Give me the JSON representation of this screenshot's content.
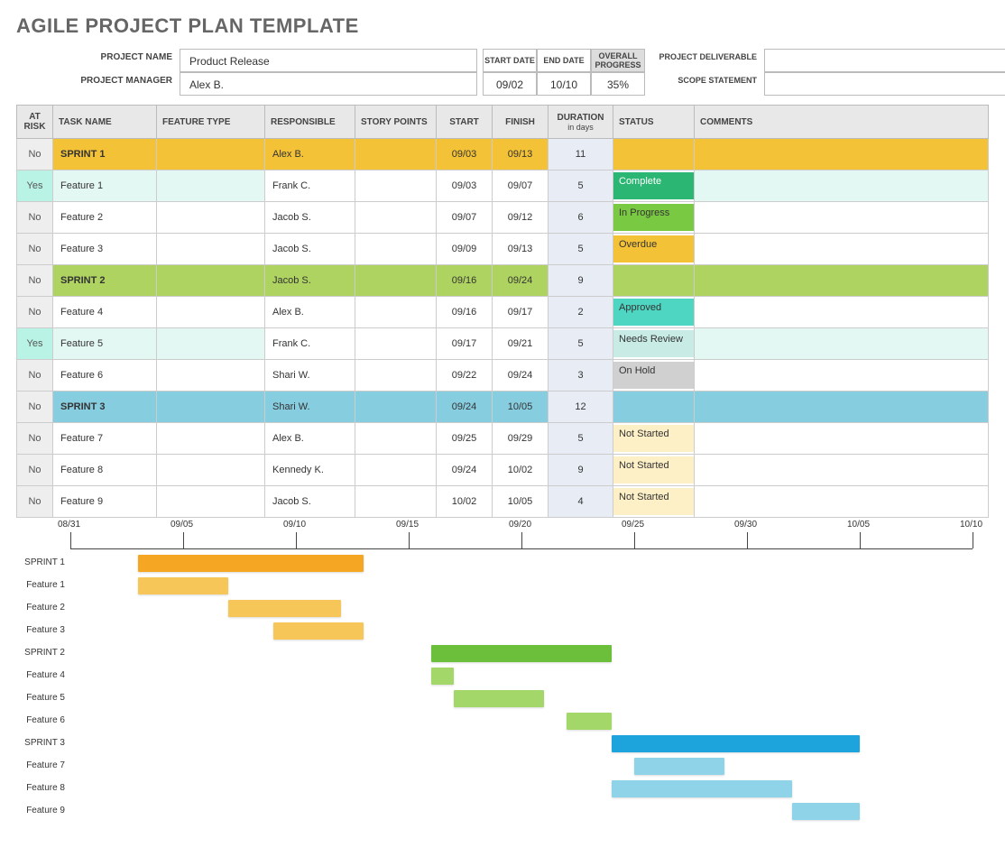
{
  "title": "AGILE PROJECT PLAN TEMPLATE",
  "header": {
    "labels": {
      "project_name": "PROJECT NAME",
      "project_manager": "PROJECT MANAGER",
      "start_date": "START DATE",
      "end_date": "END DATE",
      "overall_progress": "OVERALL PROGRESS",
      "project_deliverable": "PROJECT DELIVERABLE",
      "scope_statement": "SCOPE STATEMENT"
    },
    "project_name": "Product Release",
    "project_manager": "Alex B.",
    "start_date": "09/02",
    "end_date": "10/10",
    "overall_progress": "35%",
    "project_deliverable": "",
    "scope_statement": ""
  },
  "table": {
    "headers": {
      "at_risk": "AT RISK",
      "task_name": "TASK NAME",
      "feature_type": "FEATURE TYPE",
      "responsible": "RESPONSIBLE",
      "story_points": "STORY POINTS",
      "start": "START",
      "finish": "FINISH",
      "duration": "DURATION",
      "duration_sub": "in days",
      "status": "STATUS",
      "comments": "COMMENTS"
    },
    "rows": [
      {
        "at_risk": "No",
        "task": "SPRINT 1",
        "feature_type": "",
        "responsible": "Alex B.",
        "story_points": "",
        "start": "09/03",
        "finish": "09/13",
        "duration": "11",
        "status": "",
        "status_class": "",
        "row_class": "sprint1"
      },
      {
        "at_risk": "Yes",
        "task": "Feature 1",
        "feature_type": "",
        "responsible": "Frank C.",
        "story_points": "",
        "start": "09/03",
        "finish": "09/07",
        "duration": "5",
        "status": "Complete",
        "status_class": "st-complete",
        "row_class": "riskyes"
      },
      {
        "at_risk": "No",
        "task": "Feature 2",
        "feature_type": "",
        "responsible": "Jacob S.",
        "story_points": "",
        "start": "09/07",
        "finish": "09/12",
        "duration": "6",
        "status": "In Progress",
        "status_class": "st-inprogress",
        "row_class": ""
      },
      {
        "at_risk": "No",
        "task": "Feature 3",
        "feature_type": "",
        "responsible": "Jacob S.",
        "story_points": "",
        "start": "09/09",
        "finish": "09/13",
        "duration": "5",
        "status": "Overdue",
        "status_class": "st-overdue",
        "row_class": ""
      },
      {
        "at_risk": "No",
        "task": "SPRINT 2",
        "feature_type": "",
        "responsible": "Jacob S.",
        "story_points": "",
        "start": "09/16",
        "finish": "09/24",
        "duration": "9",
        "status": "",
        "status_class": "",
        "row_class": "sprint2"
      },
      {
        "at_risk": "No",
        "task": "Feature 4",
        "feature_type": "",
        "responsible": "Alex B.",
        "story_points": "",
        "start": "09/16",
        "finish": "09/17",
        "duration": "2",
        "status": "Approved",
        "status_class": "st-approved",
        "row_class": ""
      },
      {
        "at_risk": "Yes",
        "task": "Feature 5",
        "feature_type": "",
        "responsible": "Frank C.",
        "story_points": "",
        "start": "09/17",
        "finish": "09/21",
        "duration": "5",
        "status": "Needs Review",
        "status_class": "st-needsreview",
        "row_class": "riskyes"
      },
      {
        "at_risk": "No",
        "task": "Feature 6",
        "feature_type": "",
        "responsible": "Shari W.",
        "story_points": "",
        "start": "09/22",
        "finish": "09/24",
        "duration": "3",
        "status": "On Hold",
        "status_class": "st-onhold",
        "row_class": ""
      },
      {
        "at_risk": "No",
        "task": "SPRINT 3",
        "feature_type": "",
        "responsible": "Shari W.",
        "story_points": "",
        "start": "09/24",
        "finish": "10/05",
        "duration": "12",
        "status": "",
        "status_class": "",
        "row_class": "sprint3"
      },
      {
        "at_risk": "No",
        "task": "Feature 7",
        "feature_type": "",
        "responsible": "Alex B.",
        "story_points": "",
        "start": "09/25",
        "finish": "09/29",
        "duration": "5",
        "status": "Not Started",
        "status_class": "st-notstarted",
        "row_class": ""
      },
      {
        "at_risk": "No",
        "task": "Feature 8",
        "feature_type": "",
        "responsible": "Kennedy K.",
        "story_points": "",
        "start": "09/24",
        "finish": "10/02",
        "duration": "9",
        "status": "Not Started",
        "status_class": "st-notstarted",
        "row_class": ""
      },
      {
        "at_risk": "No",
        "task": "Feature 9",
        "feature_type": "",
        "responsible": "Jacob S.",
        "story_points": "",
        "start": "10/02",
        "finish": "10/05",
        "duration": "4",
        "status": "Not Started",
        "status_class": "st-notstarted",
        "row_class": ""
      }
    ]
  },
  "chart_data": {
    "type": "gantt",
    "x_axis": {
      "start": "08/31",
      "end": "10/10",
      "ticks": [
        "08/31",
        "09/05",
        "09/10",
        "09/15",
        "09/20",
        "09/25",
        "09/30",
        "10/05",
        "10/10"
      ]
    },
    "tasks": [
      {
        "name": "SPRINT 1",
        "start": "09/03",
        "end": "09/13",
        "group": "sprint1",
        "color": "#f5a623"
      },
      {
        "name": "Feature 1",
        "start": "09/03",
        "end": "09/07",
        "group": "s1",
        "color": "#f6c658"
      },
      {
        "name": "Feature 2",
        "start": "09/07",
        "end": "09/12",
        "group": "s1",
        "color": "#f6c658"
      },
      {
        "name": "Feature 3",
        "start": "09/09",
        "end": "09/13",
        "group": "s1",
        "color": "#f6c658"
      },
      {
        "name": "SPRINT 2",
        "start": "09/16",
        "end": "09/24",
        "group": "sprint2",
        "color": "#6bbf3b"
      },
      {
        "name": "Feature 4",
        "start": "09/16",
        "end": "09/17",
        "group": "s2",
        "color": "#a3d76a"
      },
      {
        "name": "Feature 5",
        "start": "09/17",
        "end": "09/21",
        "group": "s2",
        "color": "#a3d76a"
      },
      {
        "name": "Feature 6",
        "start": "09/22",
        "end": "09/24",
        "group": "s2",
        "color": "#a3d76a"
      },
      {
        "name": "SPRINT 3",
        "start": "09/24",
        "end": "10/05",
        "group": "sprint3",
        "color": "#1ea4dc"
      },
      {
        "name": "Feature 7",
        "start": "09/25",
        "end": "09/29",
        "group": "s3",
        "color": "#8fd3e8"
      },
      {
        "name": "Feature 8",
        "start": "09/24",
        "end": "10/02",
        "group": "s3",
        "color": "#8fd3e8"
      },
      {
        "name": "Feature 9",
        "start": "10/02",
        "end": "10/05",
        "group": "s3",
        "color": "#8fd3e8"
      }
    ]
  }
}
